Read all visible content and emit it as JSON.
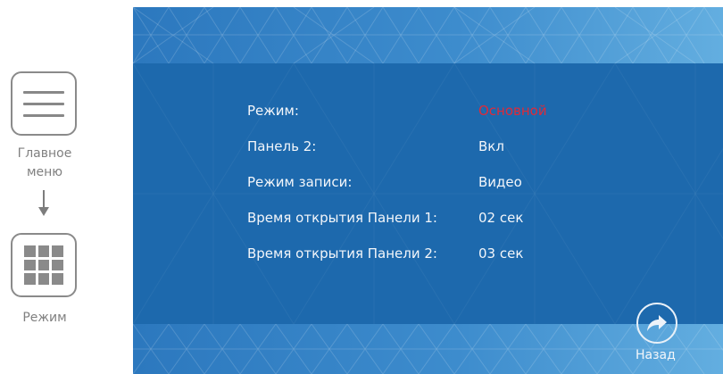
{
  "guide": {
    "main_menu_label": "Главное меню",
    "main_menu_line1": "Главное",
    "main_menu_line2": "меню",
    "mode_label": "Режим"
  },
  "settings": [
    {
      "label": "Режим:",
      "value": "Основной",
      "value_color": "#e02a38"
    },
    {
      "label": "Панель 2:",
      "value": "Вкл",
      "value_color": "#f3f6fa"
    },
    {
      "label": "Режим записи:",
      "value": "Видео",
      "value_color": "#f3f6fa"
    },
    {
      "label": "Время открытия Панели 1:",
      "value": "02 сек",
      "value_color": "#f3f6fa"
    },
    {
      "label": "Время открытия Панели 2:",
      "value": "03 сек",
      "value_color": "#f3f6fa"
    }
  ],
  "back": {
    "label": "Назад",
    "icon": "share-arrow-icon"
  },
  "colors": {
    "screen_bg": "#1d69ad",
    "accent_red": "#e02a38",
    "text": "#f3f6fa"
  }
}
